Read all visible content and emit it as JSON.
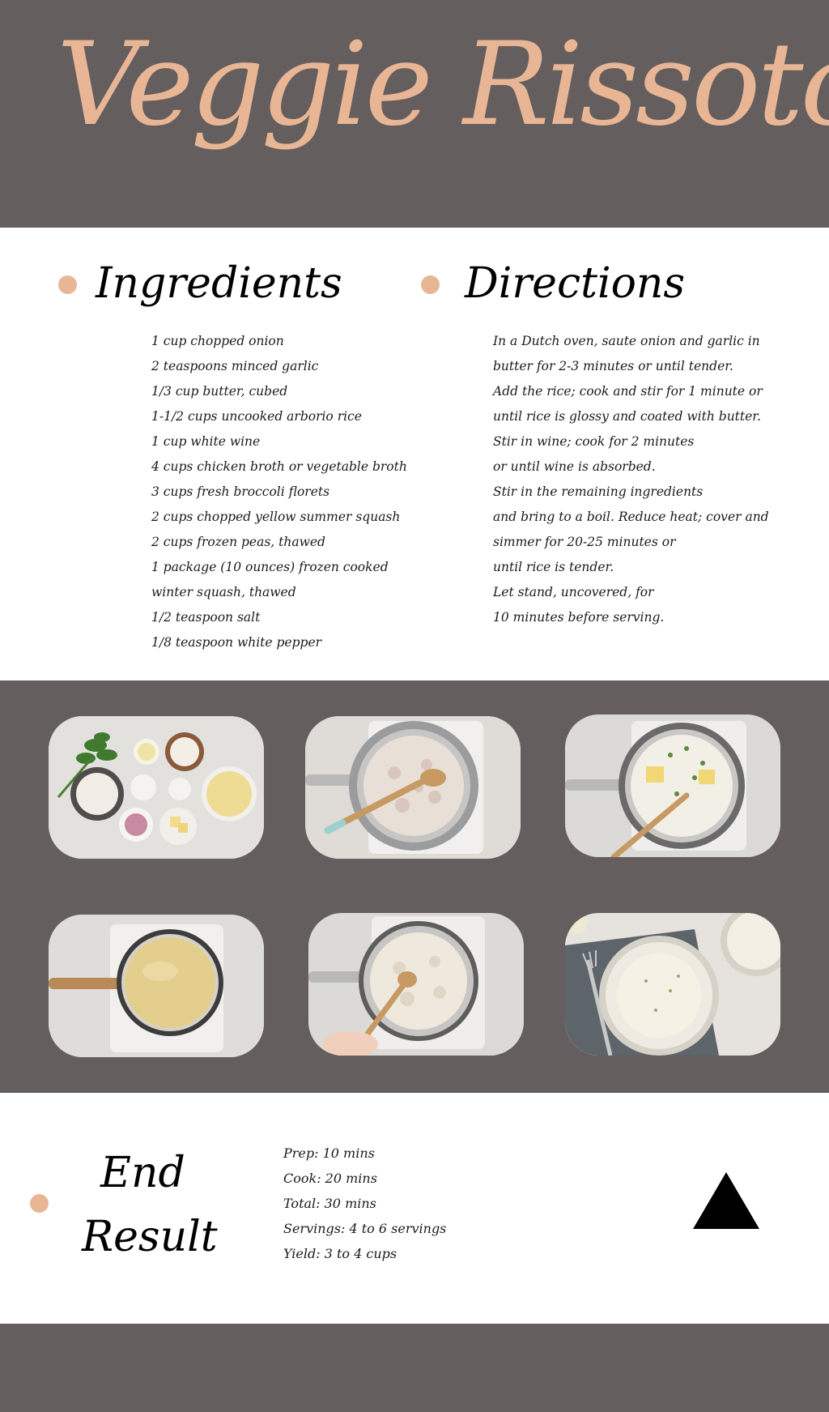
{
  "title": "Veggie Rissoto",
  "ingredients": {
    "heading": "Ingredients",
    "items": [
      "1 cup chopped onion",
      "2 teaspoons minced garlic",
      "1/3 cup butter, cubed",
      "1-1/2 cups uncooked arborio rice",
      "1 cup white wine",
      "4 cups chicken broth or vegetable broth",
      "3 cups fresh broccoli florets",
      "2 cups chopped yellow summer squash",
      "2 cups frozen peas, thawed",
      "1 package (10 ounces) frozen cooked",
      "winter squash, thawed",
      "1/2 teaspoon salt",
      "1/8 teaspoon white pepper"
    ]
  },
  "directions": {
    "heading": "Directions",
    "lines": [
      "In a Dutch oven, saute onion and garlic in",
      "butter for 2-3 minutes or until tender.",
      "Add the rice; cook and stir for 1 minute or",
      "until rice is glossy and coated with butter.",
      "Stir in wine; cook for 2 minutes",
      "or until wine is absorbed.",
      "Stir in the remaining ingredients",
      "and bring to a boil. Reduce heat; cover and",
      "simmer for 20-25 minutes or",
      "until rice is tender.",
      "Let stand, uncovered, for",
      "10 minutes before serving."
    ]
  },
  "photos": [
    {
      "icon": "ingredients-photo"
    },
    {
      "icon": "sauteing-rice-photo"
    },
    {
      "icon": "butter-herbs-photo"
    },
    {
      "icon": "broth-saucepan-photo"
    },
    {
      "icon": "stirring-risotto-photo"
    },
    {
      "icon": "risotto-bowl-photo"
    }
  ],
  "end_result": {
    "title_line1": "End",
    "title_line2": "Result",
    "stats": [
      "Prep: 10 mins",
      "Cook: 20 mins",
      "Total: 30 mins",
      "Servings: 4 to 6 servings",
      "Yield: 3 to 4 cups"
    ],
    "shape_icon": "triangle-icon"
  },
  "colors": {
    "band": "#655e5e",
    "accent": "#e8b695",
    "text": "#000000"
  }
}
